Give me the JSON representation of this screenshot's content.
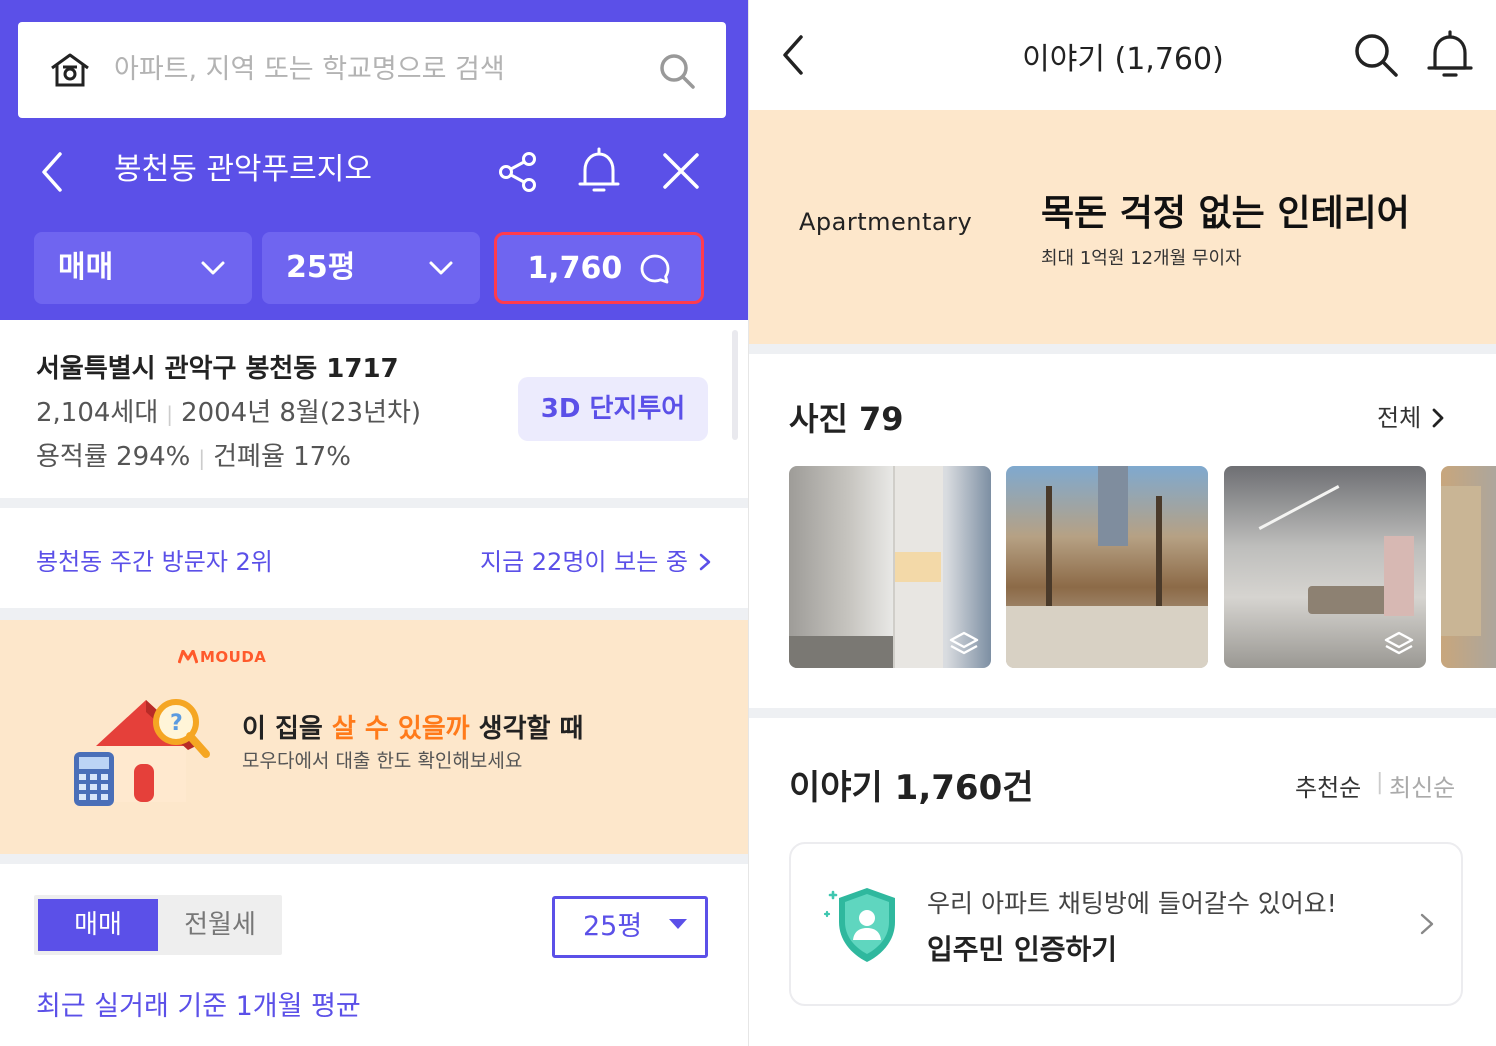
{
  "left": {
    "search": {
      "placeholder": "아파트, 지역 또는 학교명으로 검색"
    },
    "header": {
      "complex_name": "봉천동 관악푸르지오"
    },
    "filters": {
      "trade": "매매",
      "size": "25평",
      "story_count": "1,760"
    },
    "info": {
      "address": "서울특별시 관악구 봉천동 1717",
      "households": "2,104세대",
      "built": "2004년 8월(23년차)",
      "floor_area_ratio": "용적률 294%",
      "building_coverage": "건폐율 17%",
      "tour_button": "3D 단지투어"
    },
    "visitors": {
      "rank": "봉천동 주간 방문자 2위",
      "viewing": "지금 22명이 보는 중"
    },
    "ad": {
      "brand": "MOUDA",
      "headline_pre": "이 집을 ",
      "headline_hl": "살 수 있을까",
      "headline_post": " 생각할 때",
      "sub": "모우다에서 대출 한도 확인해보세요"
    },
    "price_tabs": {
      "sale": "매매",
      "rent": "전월세",
      "size": "25평"
    },
    "avg_label": "최근 실거래 기준 1개월 평균"
  },
  "right": {
    "title": "이야기 (1,760)",
    "banner": {
      "brand": "Apartmentary",
      "headline": "목돈 걱정 없는 인테리어",
      "sub": "최대 1억원 12개월 무이자"
    },
    "photos": {
      "title": "사진 79",
      "all_label": "전체"
    },
    "stories": {
      "count": "이야기 1,760건",
      "sort_recommend": "추천순",
      "sort_newest": "최신순"
    },
    "verify": {
      "line1": "우리 아파트 채팅방에 들어갈수 있어요!",
      "line2": "입주민 인증하기"
    }
  },
  "colors": {
    "brand": "#5b50e8",
    "banner_bg": "#fde7cb",
    "highlight": "#ff3b4e",
    "accent_orange": "#ff7a1a"
  },
  "icons": [
    "home-icon",
    "search-icon",
    "chevron-left-icon",
    "share-icon",
    "bell-icon",
    "close-icon",
    "chevron-down-icon",
    "speech-bubble-icon",
    "chevron-right-icon",
    "vr-layers-icon",
    "shield-icon"
  ]
}
